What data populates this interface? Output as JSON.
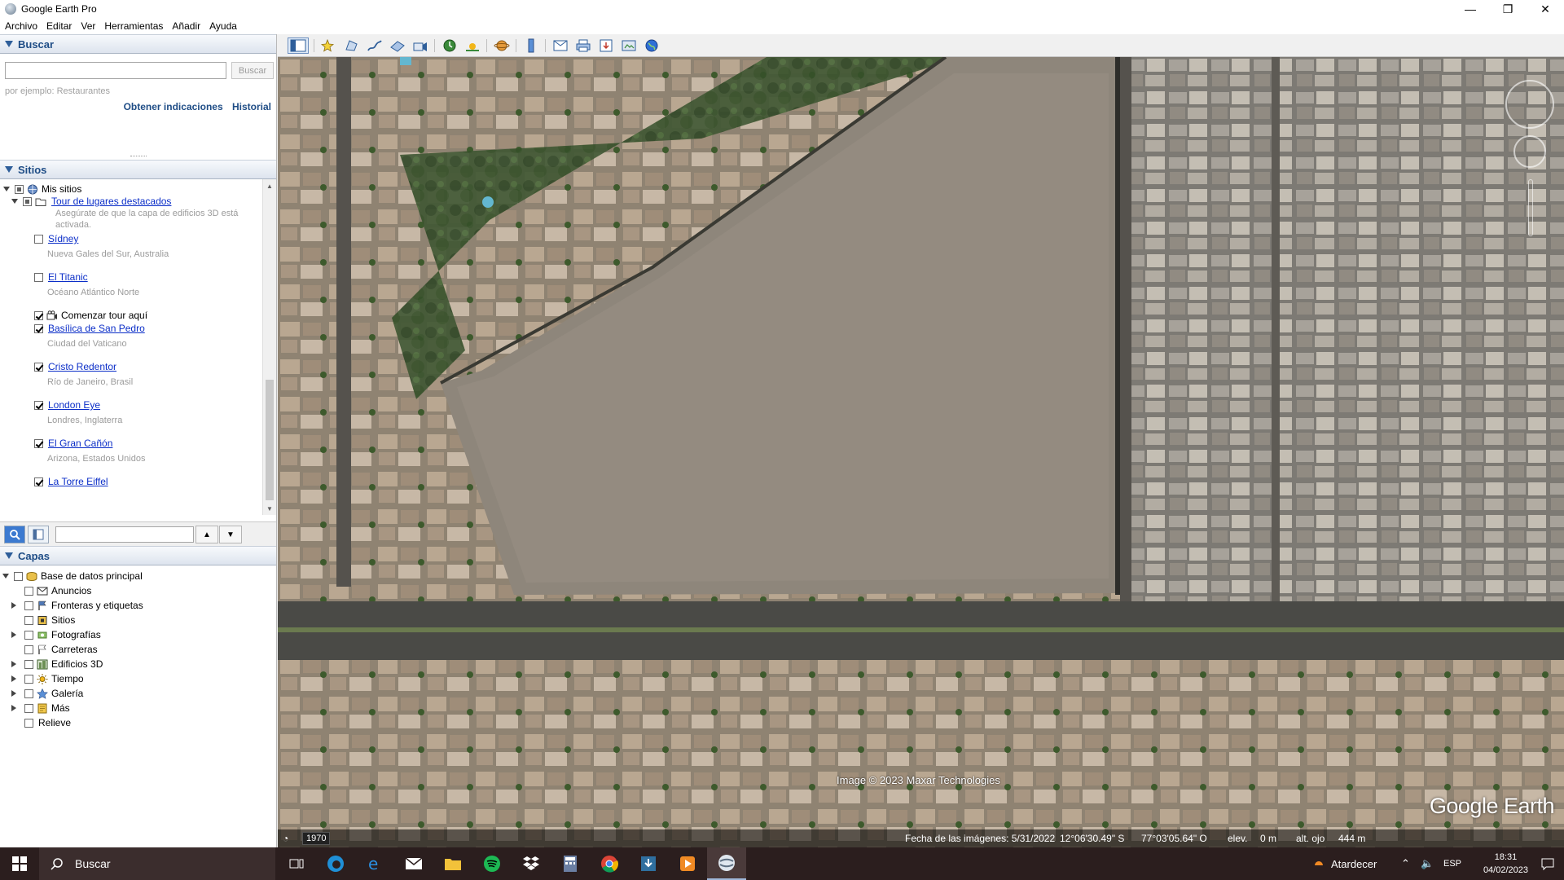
{
  "window": {
    "title": "Google Earth Pro",
    "minimize": "—",
    "maximize": "❐",
    "close": "✕"
  },
  "menu": [
    "Archivo",
    "Editar",
    "Ver",
    "Herramientas",
    "Añadir",
    "Ayuda"
  ],
  "search": {
    "header": "Buscar",
    "placeholder": "",
    "button": "Buscar",
    "hint": "por ejemplo: Restaurantes",
    "directions": "Obtener indicaciones",
    "history": "Historial"
  },
  "places": {
    "header": "Sitios",
    "root": "Mis sitios",
    "tour": "Tour de lugares destacados",
    "tour_note_1": "Asegúrate de que la capa de edificios 3D está",
    "tour_note_2": "activada.",
    "items": [
      {
        "name": "Sídney",
        "sub": "Nueva Gales del Sur, Australia",
        "checked": false
      },
      {
        "name": "El Titanic",
        "sub": "Océano Atlántico Norte",
        "checked": false
      },
      {
        "name": "Comenzar tour aquí",
        "sub": "",
        "checked": true,
        "plain": true
      },
      {
        "name": "Basílica de San Pedro",
        "sub": "Ciudad del Vaticano",
        "checked": true
      },
      {
        "name": "Cristo Redentor",
        "sub": "Río de Janeiro, Brasil",
        "checked": true
      },
      {
        "name": "London Eye",
        "sub": "Londres, Inglaterra",
        "checked": true
      },
      {
        "name": "El Gran Cañón",
        "sub": "Arizona, Estados Unidos",
        "checked": true
      },
      {
        "name": "La Torre Eiffel",
        "sub": "",
        "checked": true
      }
    ]
  },
  "layers": {
    "header": "Capas",
    "root": "Base de datos principal",
    "items": [
      {
        "name": "Anuncios",
        "expandable": false
      },
      {
        "name": "Fronteras y etiquetas",
        "expandable": true
      },
      {
        "name": "Sitios",
        "expandable": false
      },
      {
        "name": "Fotografías",
        "expandable": true
      },
      {
        "name": "Carreteras",
        "expandable": false
      },
      {
        "name": "Edificios 3D",
        "expandable": true
      },
      {
        "name": "Tiempo",
        "expandable": true
      },
      {
        "name": "Galería",
        "expandable": true
      },
      {
        "name": "Más",
        "expandable": true
      },
      {
        "name": "Relieve",
        "expandable": false
      }
    ]
  },
  "map": {
    "attribution": "Image © 2023 Maxar Technologies",
    "logo": "Google Earth",
    "year": "1970",
    "imagery_date": "Fecha de las imágenes: 5/31/2022",
    "lat": "12°06'30.49\" S",
    "lon": "77°03'05.64\" O",
    "elev_label": "elev.",
    "elev_value": "0 m",
    "eye_label": "alt. ojo",
    "eye_value": "444 m"
  },
  "taskbar": {
    "search_label": "Buscar",
    "weather": "Atardecer",
    "lang": "ESP",
    "time": "18:31",
    "date": "04/02/2023"
  },
  "colors": {
    "accent": "#1f4d86",
    "link": "#0b2ec8",
    "taskbar": "#2b1e1e"
  }
}
